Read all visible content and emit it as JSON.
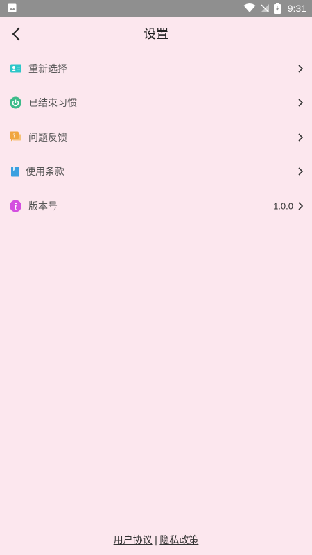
{
  "status_bar": {
    "time": "9:31"
  },
  "header": {
    "title": "设置",
    "back_icon": "chevron-left-icon"
  },
  "settings": [
    {
      "label": "重新选择",
      "icon": "contact-card-icon",
      "color": "#2ec7c9"
    },
    {
      "label": "已结束习惯",
      "icon": "power-icon",
      "color": "#3dbb8a"
    },
    {
      "label": "问题反馈",
      "icon": "feedback-bubble-icon",
      "color": "#f0a640"
    },
    {
      "label": "使用条款",
      "icon": "book-icon",
      "color": "#3aa0e0"
    },
    {
      "label": "版本号",
      "icon": "info-icon",
      "color": "#d44fe0",
      "value": "1.0.0"
    }
  ],
  "footer": {
    "user_agreement": "用户协议",
    "separator": "|",
    "privacy_policy": "隐私政策"
  }
}
